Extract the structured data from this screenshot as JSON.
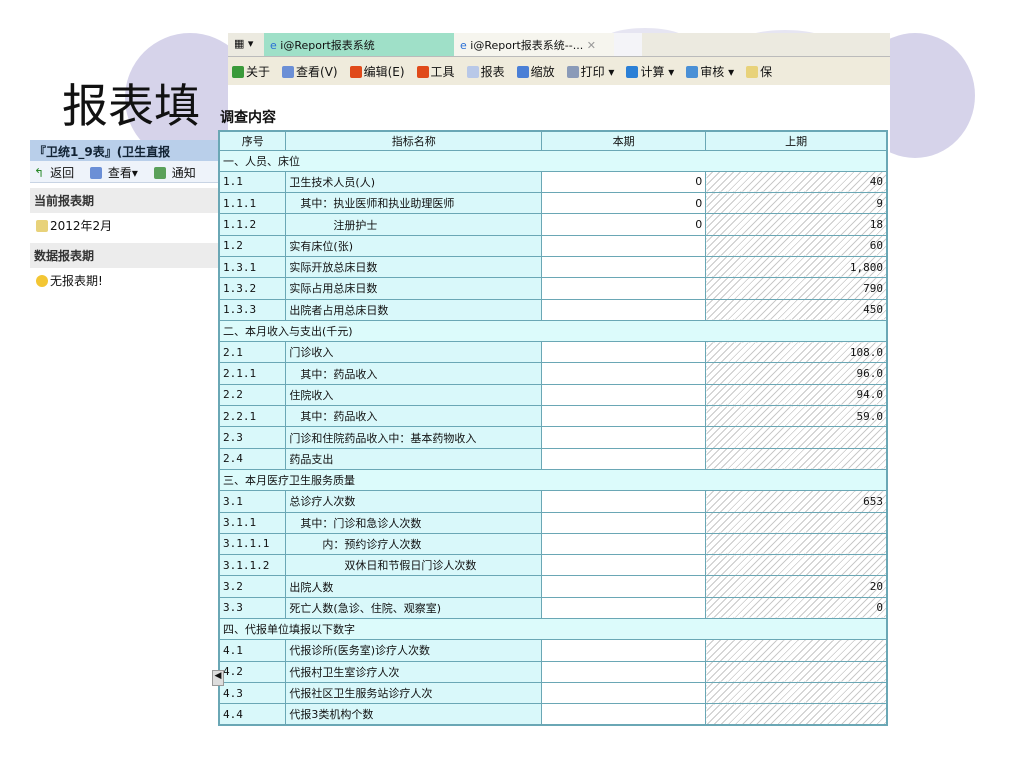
{
  "slide_title": "报表填",
  "left_panel": {
    "header": "『卫统1_9表』(卫生直报",
    "tools": [
      "返回",
      "查看▾",
      "通知"
    ],
    "current_period_label": "当前报表期",
    "current_period": "2012年2月",
    "data_period_label": "数据报表期",
    "no_period": "无报表期!"
  },
  "tabs": [
    "i@Report报表系统",
    "i@Report报表系统--..."
  ],
  "toolbar": [
    "关于",
    "查看(V)",
    "编辑(E)",
    "工具",
    "报表",
    "缩放",
    "打印 ▾",
    "计算 ▾",
    "审核 ▾",
    "保"
  ],
  "section_title": "调查内容",
  "columns": [
    "序号",
    "指标名称",
    "本期",
    "上期"
  ],
  "rows": [
    {
      "section": "一、人员、床位"
    },
    {
      "code": "1.1",
      "name": "卫生技术人员(人)",
      "cur": "0",
      "prev": "40"
    },
    {
      "code": "1.1.1",
      "name": "　其中：执业医师和执业助理医师",
      "cur": "0",
      "prev": "9"
    },
    {
      "code": "1.1.2",
      "name": "　　　　注册护士",
      "cur": "0",
      "prev": "18"
    },
    {
      "code": "1.2",
      "name": "实有床位(张)",
      "cur": "",
      "prev": "60"
    },
    {
      "code": "1.3.1",
      "name": "实际开放总床日数",
      "cur": "",
      "prev": "1,800"
    },
    {
      "code": "1.3.2",
      "name": "实际占用总床日数",
      "cur": "",
      "prev": "790"
    },
    {
      "code": "1.3.3",
      "name": "出院者占用总床日数",
      "cur": "",
      "prev": "450"
    },
    {
      "section": "二、本月收入与支出(千元)"
    },
    {
      "code": "2.1",
      "name": "门诊收入",
      "cur": "",
      "prev": "108.0"
    },
    {
      "code": "2.1.1",
      "name": "　其中：药品收入",
      "cur": "",
      "prev": "96.0"
    },
    {
      "code": "2.2",
      "name": "住院收入",
      "cur": "",
      "prev": "94.0"
    },
    {
      "code": "2.2.1",
      "name": "　其中：药品收入",
      "cur": "",
      "prev": "59.0"
    },
    {
      "code": "2.3",
      "name": "门诊和住院药品收入中：基本药物收入",
      "cur": "",
      "prev": ""
    },
    {
      "code": "2.4",
      "name": "药品支出",
      "cur": "",
      "prev": ""
    },
    {
      "section": "三、本月医疗卫生服务质量"
    },
    {
      "code": "3.1",
      "name": "总诊疗人次数",
      "cur": "",
      "prev": "653"
    },
    {
      "code": "3.1.1",
      "name": "　其中：门诊和急诊人次数",
      "cur": "",
      "prev": ""
    },
    {
      "code": "3.1.1.1",
      "name": "　　　内：预约诊疗人次数",
      "cur": "",
      "prev": ""
    },
    {
      "code": "3.1.1.2",
      "name": "　　　　　双休日和节假日门诊人次数",
      "cur": "",
      "prev": ""
    },
    {
      "code": "3.2",
      "name": "出院人数",
      "cur": "",
      "prev": "20"
    },
    {
      "code": "3.3",
      "name": "死亡人数(急诊、住院、观察室)",
      "cur": "",
      "prev": "0"
    },
    {
      "section": "四、代报单位填报以下数字"
    },
    {
      "code": "4.1",
      "name": "代报诊所(医务室)诊疗人次数",
      "cur": "",
      "prev": ""
    },
    {
      "code": "4.2",
      "name": "代报村卫生室诊疗人次",
      "cur": "",
      "prev": ""
    },
    {
      "code": "4.3",
      "name": "代报社区卫生服务站诊疗人次",
      "cur": "",
      "prev": ""
    },
    {
      "code": "4.4",
      "name": "代报3类机构个数",
      "cur": "",
      "prev": ""
    }
  ]
}
